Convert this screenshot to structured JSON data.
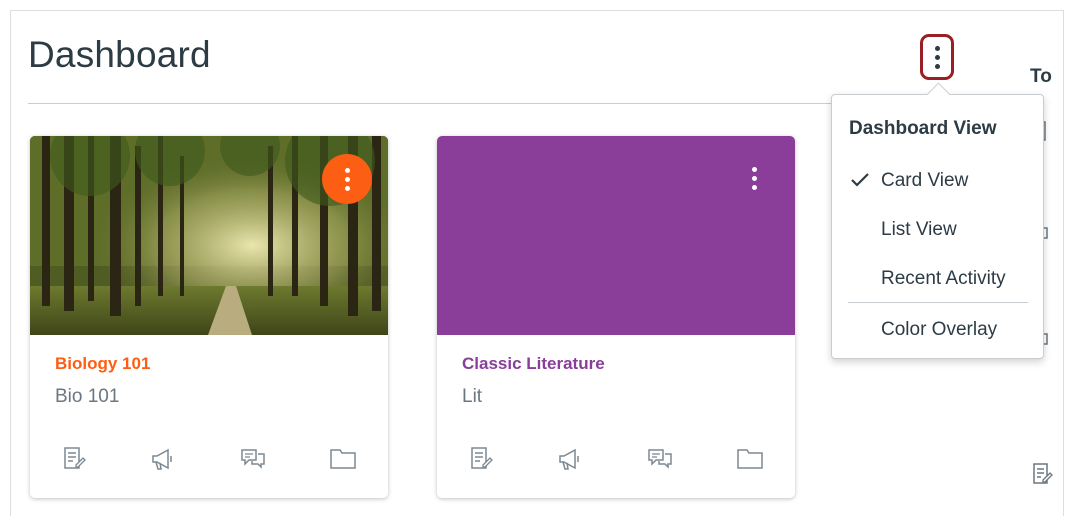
{
  "page": {
    "title": "Dashboard",
    "todo_heading": "To"
  },
  "options_menu": {
    "heading": "Dashboard View",
    "items": [
      {
        "label": "Card View",
        "selected": true
      },
      {
        "label": "List View",
        "selected": false
      },
      {
        "label": "Recent Activity",
        "selected": false
      },
      {
        "label": "Color Overlay",
        "selected": false
      }
    ]
  },
  "cards": [
    {
      "name": "Biology 101",
      "code": "Bio 101",
      "color": "#fc5e13",
      "hero": "forest-image",
      "actions": [
        "assignments-icon",
        "announcements-icon",
        "discussions-icon",
        "files-icon"
      ]
    },
    {
      "name": "Classic Literature",
      "code": "Lit",
      "color": "#8b3d9a",
      "hero": "solid-color",
      "actions": [
        "assignments-icon",
        "announcements-icon",
        "discussions-icon",
        "files-icon"
      ]
    }
  ],
  "colors": {
    "text": "#2d3b45",
    "highlight_border": "#9a1f24"
  }
}
